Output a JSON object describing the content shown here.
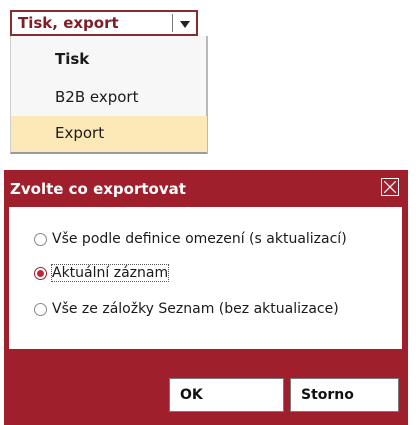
{
  "dropdown": {
    "selected": "Tisk, export",
    "items": [
      {
        "label": "Tisk",
        "state": "default"
      },
      {
        "label": "B2B export",
        "state": "default"
      },
      {
        "label": "Export",
        "state": "highlighted"
      }
    ]
  },
  "dialog": {
    "title": "Zvolte co exportovat",
    "options": [
      {
        "label": "Vše podle definice omezení (s aktualizací)",
        "checked": false
      },
      {
        "label": "Aktuální záznam",
        "checked": true
      },
      {
        "label": "Vše ze záložky Seznam (bez aktualizace)",
        "checked": false
      }
    ],
    "ok_label": "OK",
    "cancel_label": "Storno"
  },
  "colors": {
    "accent": "#a01f2d",
    "highlight": "#fde9b8"
  }
}
